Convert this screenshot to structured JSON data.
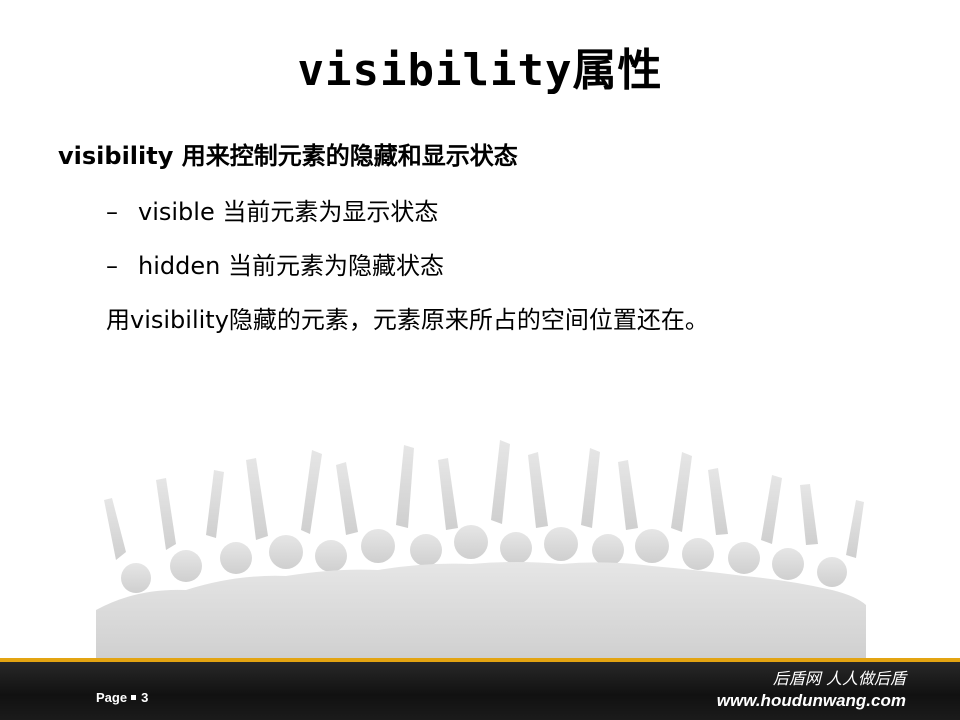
{
  "slide": {
    "title": "visibility属性",
    "lead": "visibility 用来控制元素的隐藏和显示状态",
    "bullets": [
      {
        "dash": "–",
        "text": "visible 当前元素为显示状态"
      },
      {
        "dash": "–",
        "text": "hidden 当前元素为隐藏状态"
      }
    ],
    "note": "用visibility隐藏的元素，元素原来所占的空间位置还在。"
  },
  "footer": {
    "page_label": "Page",
    "page_number": "3",
    "slogan": "后盾网 人人做后盾",
    "url": "www.houdunwang.com"
  },
  "colors": {
    "accent": "#e3a412",
    "footer_bg": "#1b1b1b",
    "crowd": "#d9d9d9"
  }
}
